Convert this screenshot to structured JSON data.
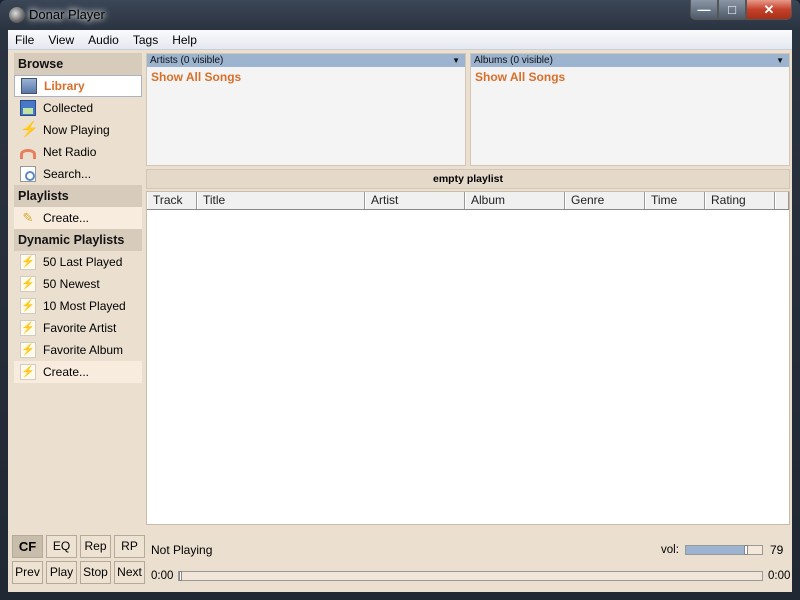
{
  "window": {
    "title": "Donar Player"
  },
  "menu": [
    "File",
    "View",
    "Audio",
    "Tags",
    "Help"
  ],
  "sidebar": {
    "browse_label": "Browse",
    "browse": [
      {
        "label": "Library",
        "icon": "library-icon",
        "selected": true
      },
      {
        "label": "Collected",
        "icon": "collected-icon"
      },
      {
        "label": "Now Playing",
        "icon": "now-playing-icon"
      },
      {
        "label": "Net Radio",
        "icon": "net-radio-icon"
      },
      {
        "label": "Search...",
        "icon": "search-icon"
      }
    ],
    "playlists_label": "Playlists",
    "playlists": [
      {
        "label": "Create...",
        "icon": "pencil-icon"
      }
    ],
    "dynamic_label": "Dynamic Playlists",
    "dynamic": [
      {
        "label": "50 Last Played"
      },
      {
        "label": "50 Newest"
      },
      {
        "label": "10 Most Played"
      },
      {
        "label": "Favorite Artist"
      },
      {
        "label": "Favorite Album"
      },
      {
        "label": "Create..."
      }
    ]
  },
  "filters": {
    "artists": {
      "header": "Artists (0 visible)",
      "show_all": "Show All Songs"
    },
    "albums": {
      "header": "Albums (0 visible)",
      "show_all": "Show All Songs"
    }
  },
  "playlist": {
    "title": "empty playlist",
    "columns": [
      "Track",
      "Title",
      "Artist",
      "Album",
      "Genre",
      "Time",
      "Rating"
    ]
  },
  "controls": {
    "buttons_row1": [
      "CF",
      "EQ",
      "Rep",
      "RP"
    ],
    "buttons_row2": [
      "Prev",
      "Play",
      "Stop",
      "Next"
    ],
    "cf_active": true,
    "status": "Not Playing",
    "vol_label": "vol:",
    "volume": 79,
    "time_elapsed": "0:00",
    "time_total": "0:00",
    "progress": 0
  }
}
